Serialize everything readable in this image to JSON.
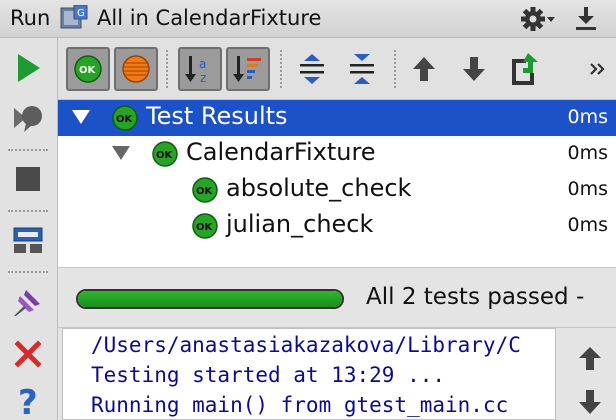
{
  "title_bar": {
    "run_label": "Run",
    "config_icon": "test-config-icon",
    "config_name": "All in CalendarFixture",
    "settings_icon": "gear-icon",
    "hide_icon": "hide-panel-icon"
  },
  "left_toolbar": {
    "items": [
      "rerun-icon",
      "toggle-auto-test-icon",
      "stop-icon",
      "restore-layout-icon",
      "pin-icon",
      "close-icon",
      "help-icon"
    ]
  },
  "tests_toolbar": {
    "items": [
      "show-passed-icon",
      "show-ignored-icon",
      "sort-alphabetically-icon",
      "sort-by-duration-icon",
      "expand-all-icon",
      "collapse-all-icon",
      "previous-failed-icon",
      "next-failed-icon",
      "export-results-icon",
      "more-icon"
    ]
  },
  "tree": {
    "rows": [
      {
        "name": "Test Results",
        "time": "0ms",
        "status": "OK",
        "selected": true
      },
      {
        "name": "CalendarFixture",
        "time": "0ms",
        "status": "OK",
        "selected": false
      },
      {
        "name": "absolute_check",
        "time": "0ms",
        "status": "OK",
        "selected": false
      },
      {
        "name": "julian_check",
        "time": "0ms",
        "status": "OK",
        "selected": false
      }
    ]
  },
  "status": {
    "text": "All 2 tests passed -",
    "progress": 1.0
  },
  "console": {
    "lines": [
      "/Users/anastasiakazakova/Library/C",
      "Testing started at 13:29 ...",
      "Running main() from gtest_main.cc"
    ]
  },
  "colors": {
    "selection": "#1c51c7",
    "ok_green": "#27a327",
    "console_text": "#0c0c8c"
  }
}
